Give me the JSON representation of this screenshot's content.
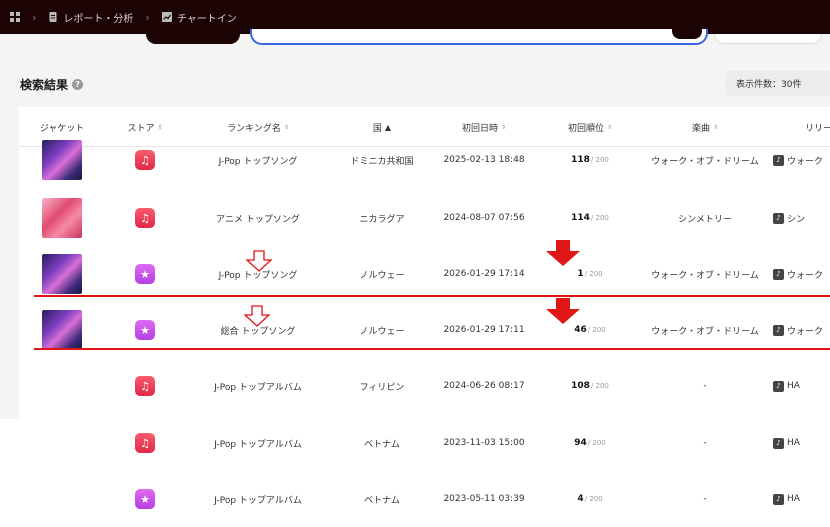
{
  "breadcrumb": {
    "items": [
      "レポート・分析",
      "チャートイン"
    ]
  },
  "results": {
    "title": "検索結果",
    "help": "?",
    "count_label": "表示件数：30件"
  },
  "table": {
    "headers": {
      "jacket": "ジャケット",
      "store": "ストア",
      "ranking": "ランキング名",
      "country": "国",
      "country_sort": "▲",
      "first_date": "初回日時",
      "first_rank": "初回順位",
      "song": "楽曲",
      "release": "リリー"
    },
    "sort_glyph": "⇕",
    "rows": [
      {
        "jacket": "jk1",
        "store": "apple",
        "store_glyph": "♫",
        "ranking": "J-Pop トップソング",
        "country": "ドミニカ共和国",
        "date": "2025-02-13 18:48",
        "rank": "118",
        "total": "/ 200",
        "song": "ウォーク・オブ・ドリーム",
        "release": "ウォーク"
      },
      {
        "jacket": "jk2",
        "store": "apple",
        "store_glyph": "♫",
        "ranking": "アニメ トップソング",
        "country": "ニカラグア",
        "date": "2024-08-07 07:56",
        "rank": "114",
        "total": "/ 200",
        "song": "シンメトリー",
        "release": "シン"
      },
      {
        "jacket": "jk1",
        "store": "itunes",
        "store_glyph": "★",
        "ranking": "J-Pop トップソング",
        "country": "ノルウェー",
        "date": "2026-01-29 17:14",
        "rank": "1",
        "total": "/ 200",
        "song": "ウォーク・オブ・ドリーム",
        "release": "ウォーク"
      },
      {
        "jacket": "jk1",
        "store": "itunes",
        "store_glyph": "★",
        "ranking": "総合 トップソング",
        "country": "ノルウェー",
        "date": "2026-01-29 17:11",
        "rank": "46",
        "total": "/ 200",
        "song": "ウォーク・オブ・ドリーム",
        "release": "ウォーク"
      },
      {
        "jacket": "",
        "store": "apple",
        "store_glyph": "♫",
        "ranking": "J-Pop トップアルバム",
        "country": "フィリピン",
        "date": "2024-06-26 08:17",
        "rank": "108",
        "total": "/ 200",
        "song": "-",
        "release": "HA"
      },
      {
        "jacket": "",
        "store": "apple",
        "store_glyph": "♫",
        "ranking": "J-Pop トップアルバム",
        "country": "ベトナム",
        "date": "2023-11-03 15:00",
        "rank": "94",
        "total": "/ 200",
        "song": "-",
        "release": "HA"
      },
      {
        "jacket": "",
        "store": "itunes",
        "store_glyph": "★",
        "ranking": "J-Pop トップアルバム",
        "country": "ベトナム",
        "date": "2023-05-11 03:39",
        "rank": "4",
        "total": "/ 200",
        "song": "-",
        "release": "HA"
      }
    ]
  },
  "colors": {
    "topbar": "#1c0405",
    "highlight": "#e01515",
    "search_border": "#3a66e6"
  }
}
